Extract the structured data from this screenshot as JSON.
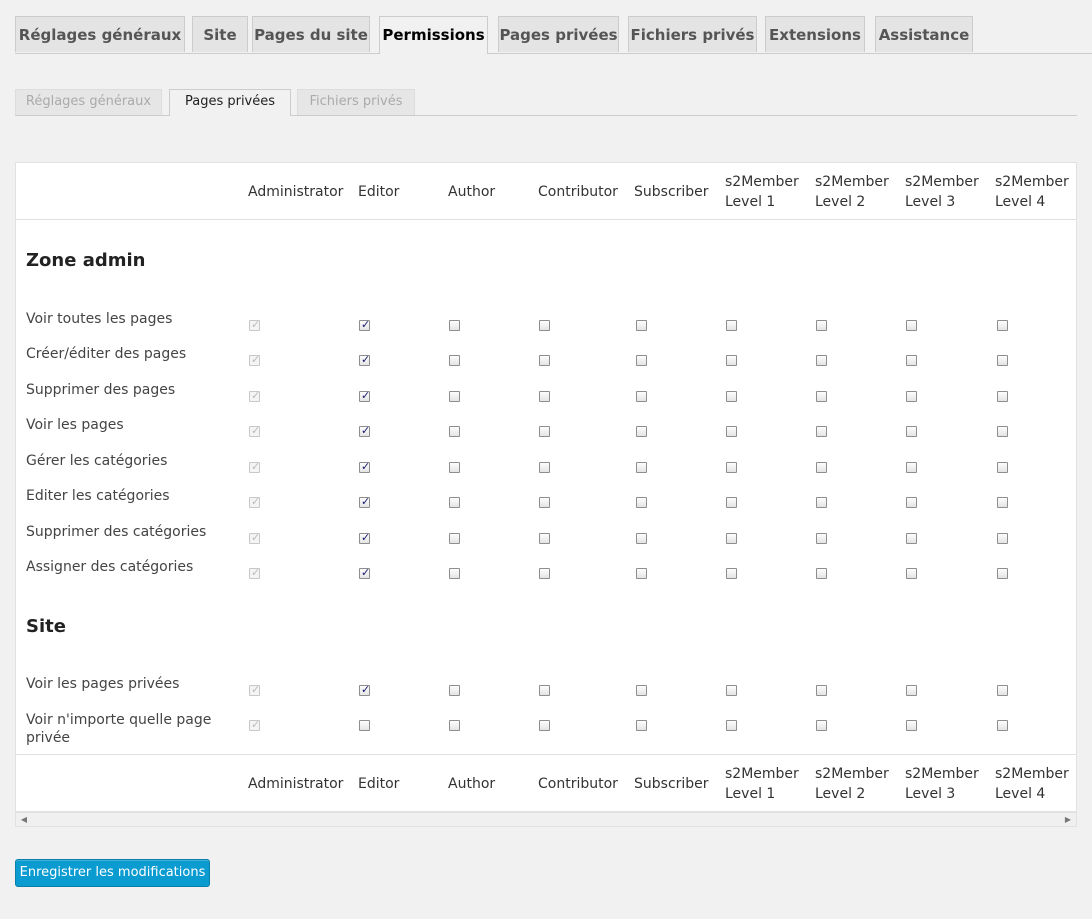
{
  "main_tabs": [
    "Réglages généraux",
    "Site",
    "Pages du site",
    "Permissions",
    "Pages privées",
    "Fichiers privés",
    "Extensions",
    "Assistance"
  ],
  "main_tab_active": "Permissions",
  "sub_tabs": [
    "Réglages généraux",
    "Pages privées",
    "Fichiers privés"
  ],
  "sub_tab_active": "Pages privées",
  "columns": [
    {
      "line1": "Administrator",
      "line2": ""
    },
    {
      "line1": "Editor",
      "line2": ""
    },
    {
      "line1": "Author",
      "line2": ""
    },
    {
      "line1": "Contributor",
      "line2": ""
    },
    {
      "line1": "Subscriber",
      "line2": ""
    },
    {
      "line1": "s2Member",
      "line2": "Level 1"
    },
    {
      "line1": "s2Member",
      "line2": "Level 2"
    },
    {
      "line1": "s2Member",
      "line2": "Level 3"
    },
    {
      "line1": "s2Member",
      "line2": "Level 4"
    }
  ],
  "sections": [
    {
      "title": "Zone admin",
      "rows": [
        {
          "label": "Voir toutes les pages",
          "checked": [
            true,
            true,
            false,
            false,
            false,
            false,
            false,
            false,
            false
          ]
        },
        {
          "label": "Créer/éditer des pages",
          "checked": [
            true,
            true,
            false,
            false,
            false,
            false,
            false,
            false,
            false
          ]
        },
        {
          "label": "Supprimer des pages",
          "checked": [
            true,
            true,
            false,
            false,
            false,
            false,
            false,
            false,
            false
          ]
        },
        {
          "label": "Voir les pages",
          "checked": [
            true,
            true,
            false,
            false,
            false,
            false,
            false,
            false,
            false
          ]
        },
        {
          "label": "Gérer les catégories",
          "checked": [
            true,
            true,
            false,
            false,
            false,
            false,
            false,
            false,
            false
          ]
        },
        {
          "label": "Editer les catégories",
          "checked": [
            true,
            true,
            false,
            false,
            false,
            false,
            false,
            false,
            false
          ]
        },
        {
          "label": "Supprimer des catégories",
          "checked": [
            true,
            true,
            false,
            false,
            false,
            false,
            false,
            false,
            false
          ]
        },
        {
          "label": "Assigner des catégories",
          "checked": [
            true,
            true,
            false,
            false,
            false,
            false,
            false,
            false,
            false
          ]
        }
      ]
    },
    {
      "title": "Site",
      "rows": [
        {
          "label": "Voir les pages privées",
          "checked": [
            true,
            true,
            false,
            false,
            false,
            false,
            false,
            false,
            false
          ]
        },
        {
          "label": "Voir n'importe quelle page privée",
          "checked": [
            true,
            false,
            false,
            false,
            false,
            false,
            false,
            false,
            false
          ]
        }
      ]
    }
  ],
  "disabled_column": 0,
  "save_button": "Enregistrer les modifications",
  "colors": {
    "accent": "#0a9bd1",
    "background": "#f1f1f1"
  }
}
